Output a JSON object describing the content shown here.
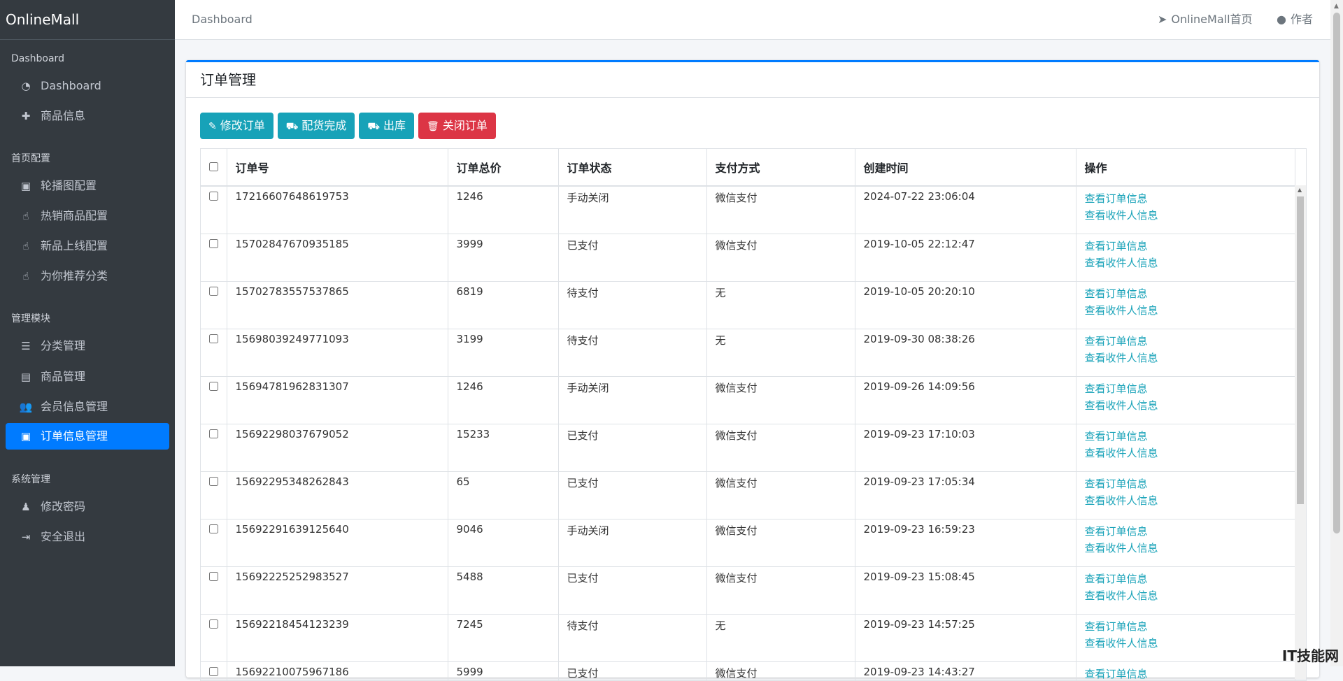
{
  "sidebar": {
    "brand": "OnlineMall",
    "sections": [
      {
        "header": "Dashboard",
        "items": [
          {
            "label": "Dashboard",
            "icon": "tachometer-icon"
          },
          {
            "label": "商品信息",
            "icon": "plus-icon"
          }
        ]
      },
      {
        "header": "首页配置",
        "items": [
          {
            "label": "轮播图配置",
            "icon": "image-icon"
          },
          {
            "label": "热销商品配置",
            "icon": "hand-pointer-icon"
          },
          {
            "label": "新品上线配置",
            "icon": "hand-pointer-icon"
          },
          {
            "label": "为你推荐分类",
            "icon": "hand-pointer-icon"
          }
        ]
      },
      {
        "header": "管理模块",
        "items": [
          {
            "label": "分类管理",
            "icon": "list-icon"
          },
          {
            "label": "商品管理",
            "icon": "archive-icon"
          },
          {
            "label": "会员信息管理",
            "icon": "users-icon"
          },
          {
            "label": "订单信息管理",
            "icon": "money-icon",
            "active": true
          }
        ]
      },
      {
        "header": "系统管理",
        "items": [
          {
            "label": "修改密码",
            "icon": "user-secret-icon"
          },
          {
            "label": "安全退出",
            "icon": "sign-out-icon"
          }
        ]
      }
    ]
  },
  "topbar": {
    "breadcrumb": "Dashboard",
    "home_link": "OnlineMall首页",
    "author_link": "作者"
  },
  "card": {
    "title": "订单管理",
    "buttons": {
      "edit": "修改订单",
      "pack": "配货完成",
      "ship": "出库",
      "close": "关闭订单"
    }
  },
  "table": {
    "columns": [
      "订单号",
      "订单总价",
      "订单状态",
      "支付方式",
      "创建时间",
      "操作"
    ],
    "op_view_order": "查看订单信息",
    "op_view_receiver": "查看收件人信息",
    "rows": [
      {
        "no": "17216607648619753",
        "total": "1246",
        "status": "手动关闭",
        "pay": "微信支付",
        "time": "2024-07-22 23:06:04"
      },
      {
        "no": "15702847670935185",
        "total": "3999",
        "status": "已支付",
        "pay": "微信支付",
        "time": "2019-10-05 22:12:47"
      },
      {
        "no": "15702783557537865",
        "total": "6819",
        "status": "待支付",
        "pay": "无",
        "time": "2019-10-05 20:20:10"
      },
      {
        "no": "15698039249771093",
        "total": "3199",
        "status": "待支付",
        "pay": "无",
        "time": "2019-09-30 08:38:26"
      },
      {
        "no": "15694781962831307",
        "total": "1246",
        "status": "手动关闭",
        "pay": "微信支付",
        "time": "2019-09-26 14:09:56"
      },
      {
        "no": "15692298037679052",
        "total": "15233",
        "status": "已支付",
        "pay": "微信支付",
        "time": "2019-09-23 17:10:03"
      },
      {
        "no": "15692295348262843",
        "total": "65",
        "status": "已支付",
        "pay": "微信支付",
        "time": "2019-09-23 17:05:34"
      },
      {
        "no": "15692291639125640",
        "total": "9046",
        "status": "手动关闭",
        "pay": "微信支付",
        "time": "2019-09-23 16:59:23"
      },
      {
        "no": "15692225252983527",
        "total": "5488",
        "status": "已支付",
        "pay": "微信支付",
        "time": "2019-09-23 15:08:45"
      },
      {
        "no": "15692218454123239",
        "total": "7245",
        "status": "待支付",
        "pay": "无",
        "time": "2019-09-23 14:57:25"
      },
      {
        "no": "15692210075967186",
        "total": "5999",
        "status": "已支付",
        "pay": "微信支付",
        "time": "2019-09-23 14:43:27"
      }
    ]
  },
  "watermark": "IT技能网",
  "colors": {
    "primary": "#007bff",
    "info": "#17a2b8",
    "danger": "#dc3545",
    "sidebar": "#343a40"
  }
}
